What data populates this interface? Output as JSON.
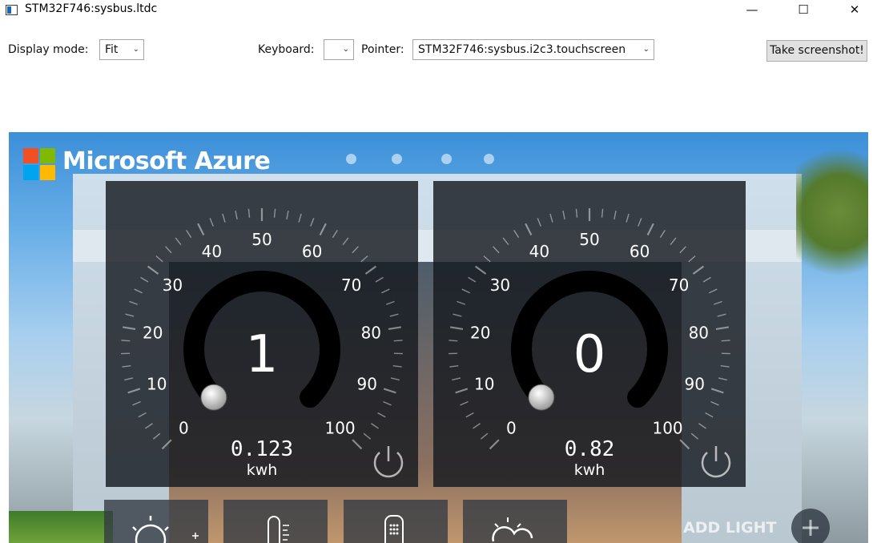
{
  "window": {
    "title": "STM32F746:sysbus.ltdc",
    "minimize_glyph": "—",
    "maximize_glyph": "☐",
    "close_glyph": "✕"
  },
  "toolbar": {
    "display_mode_label": "Display mode:",
    "display_mode_value": "Fit",
    "keyboard_label": "Keyboard:",
    "keyboard_value": "",
    "pointer_label": "Pointer:",
    "pointer_value": "STM32F746:sysbus.i2c3.touchscreen",
    "screenshot_label": "Take screenshot!",
    "dropdown_glyph": "⌄"
  },
  "device_screen": {
    "brand": "Microsoft Azure",
    "page_dots": 4,
    "gauges": [
      {
        "value": "1",
        "energy": "0.123",
        "unit": "kwh",
        "ticks": [
          "0",
          "10",
          "20",
          "30",
          "40",
          "50",
          "60",
          "70",
          "80",
          "90",
          "100"
        ]
      },
      {
        "value": "0",
        "energy": "0.82",
        "unit": "kwh",
        "ticks": [
          "0",
          "10",
          "20",
          "30",
          "40",
          "50",
          "60",
          "70",
          "80",
          "90",
          "100"
        ]
      }
    ],
    "tiles": [
      "light-bulb-icon",
      "thermometer-icon",
      "remote-icon",
      "weather-icon"
    ],
    "add_light_label": "ADD LIGHT",
    "colors": {
      "logo_red": "#f25022",
      "logo_green": "#7fba00",
      "logo_blue": "#00a4ef",
      "logo_yellow": "#ffb900",
      "panel": "#1a1e24",
      "arc": "#000000"
    }
  }
}
